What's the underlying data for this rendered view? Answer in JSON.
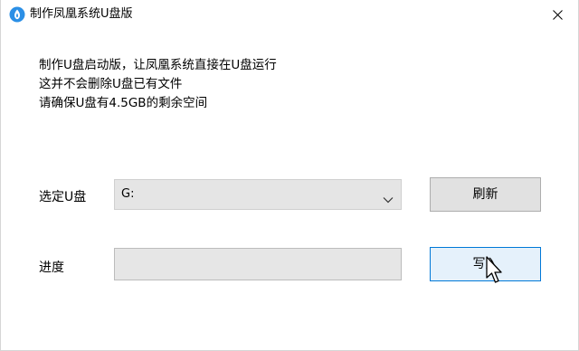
{
  "window": {
    "title": "制作凤凰系统U盘版",
    "icon": "phoenix-app-icon",
    "close_icon": "close-icon"
  },
  "info": {
    "lines": [
      "制作U盘启动版，让凤凰系统直接在U盘运行",
      "这并不会删除U盘已有文件",
      "请确保U盘有4.5GB的剩余空间"
    ]
  },
  "drive": {
    "label": "选定U盘",
    "selected": "G:",
    "refresh_label": "刷新"
  },
  "progress": {
    "label": "进度",
    "value": 0,
    "write_label": "写入"
  },
  "colors": {
    "accent": "#0078d7",
    "icon_blue": "#2b8fe6",
    "button_face": "#e1e1e1",
    "button_hover": "#e5f1fb"
  }
}
